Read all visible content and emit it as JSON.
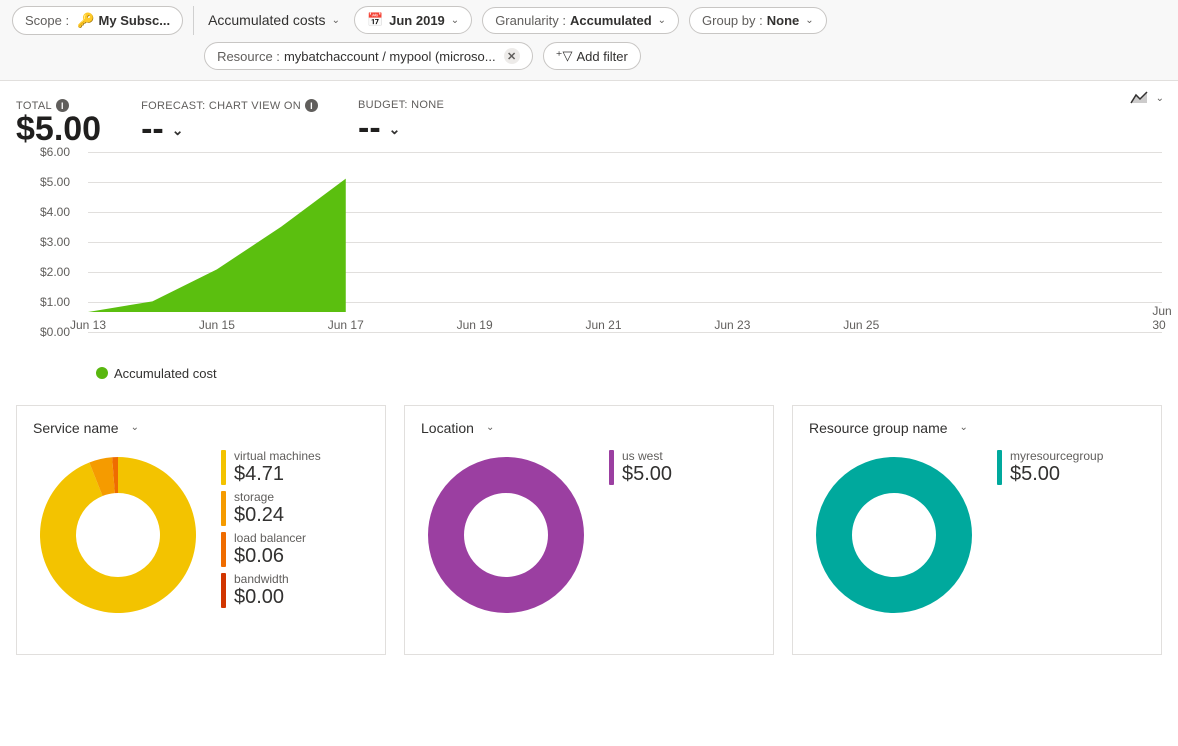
{
  "topbar": {
    "scope": {
      "label": "Scope :",
      "value": "My Subsc..."
    },
    "accumulated_costs": "Accumulated costs",
    "date": "Jun 2019",
    "granularity": {
      "label": "Granularity :",
      "value": "Accumulated"
    },
    "groupby": {
      "label": "Group by :",
      "value": "None"
    },
    "resource": {
      "label": "Resource :",
      "value": "mybatchaccount / mypool (microso..."
    },
    "add_filter": "Add filter"
  },
  "summary": {
    "total_label": "TOTAL",
    "total_value": "$5.00",
    "forecast_label": "FORECAST: CHART VIEW ON",
    "forecast_value": "--",
    "budget_label": "BUDGET: NONE",
    "budget_value": "--"
  },
  "chart_data": {
    "type": "area",
    "title": "",
    "xlabel": "",
    "ylabel": "",
    "ylim": [
      0,
      6
    ],
    "y_ticks": [
      "$0.00",
      "$1.00",
      "$2.00",
      "$3.00",
      "$4.00",
      "$5.00",
      "$6.00"
    ],
    "x_ticks": [
      "Jun 13",
      "Jun 15",
      "Jun 17",
      "Jun 19",
      "Jun 21",
      "Jun 23",
      "Jun 25",
      "Jun 30"
    ],
    "series": [
      {
        "name": "Accumulated cost",
        "color": "#5bbf0f",
        "x": [
          "Jun 13",
          "Jun 14",
          "Jun 15",
          "Jun 16",
          "Jun 17"
        ],
        "values": [
          0.0,
          0.4,
          1.6,
          3.2,
          5.0
        ]
      }
    ]
  },
  "cards": {
    "service": {
      "title": "Service name",
      "items": [
        {
          "name": "virtual machines",
          "value_text": "$4.71",
          "value": 4.71,
          "color": "#f3c300"
        },
        {
          "name": "storage",
          "value_text": "$0.24",
          "value": 0.24,
          "color": "#f59b00"
        },
        {
          "name": "load balancer",
          "value_text": "$0.06",
          "value": 0.06,
          "color": "#ef6c00"
        },
        {
          "name": "bandwidth",
          "value_text": "$0.00",
          "value": 0.0,
          "color": "#d13500"
        }
      ]
    },
    "location": {
      "title": "Location",
      "items": [
        {
          "name": "us west",
          "value_text": "$5.00",
          "value": 5.0,
          "color": "#9b3fa1"
        }
      ]
    },
    "rg": {
      "title": "Resource group name",
      "items": [
        {
          "name": "myresourcegroup",
          "value_text": "$5.00",
          "value": 5.0,
          "color": "#00a99d"
        }
      ]
    }
  }
}
